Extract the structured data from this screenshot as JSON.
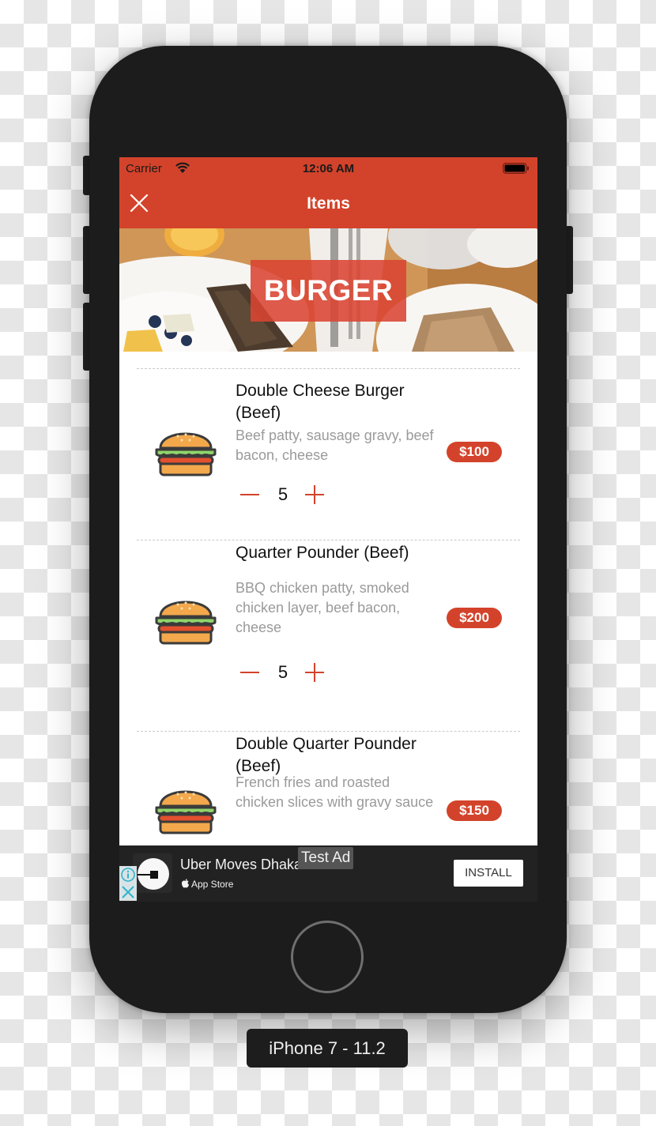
{
  "status_bar": {
    "carrier": "Carrier",
    "time": "12:06 AM",
    "icons": [
      "wifi-icon",
      "battery-icon"
    ]
  },
  "nav_bar": {
    "title": "Items",
    "close_icon": "close-icon"
  },
  "hero": {
    "category": "BURGER"
  },
  "items": [
    {
      "name": "Double Cheese Burger (Beef)",
      "description": "Beef patty, sausage gravy, beef bacon, cheese",
      "price": "$100",
      "quantity": "5",
      "icon": "burger-icon"
    },
    {
      "name": "Quarter Pounder (Beef)",
      "description": "BBQ chicken patty, smoked chicken layer, beef bacon, cheese",
      "price": "$200",
      "quantity": "5",
      "icon": "burger-icon"
    },
    {
      "name": "Double Quarter Pounder (Beef)",
      "description": "French fries and roasted chicken slices with gravy sauce",
      "price": "$150",
      "quantity": "",
      "icon": "burger-icon"
    }
  ],
  "ad": {
    "title": "Uber Moves Dhaka",
    "store": "App Store",
    "badge": "Test Ad",
    "install_label": "INSTALL"
  },
  "device": {
    "label": "iPhone 7 - 11.2"
  },
  "colors": {
    "accent": "#d3432b",
    "body_bezel": "#1c1c1c",
    "description_text": "#9a9a9a"
  }
}
